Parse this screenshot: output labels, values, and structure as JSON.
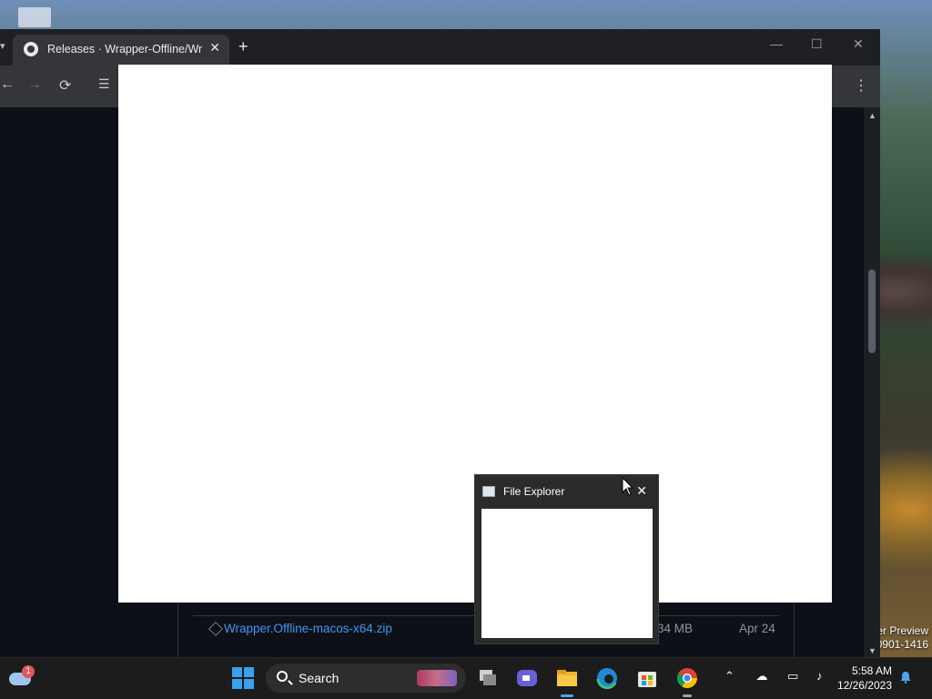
{
  "desktop": {
    "watermark_line1": "er Preview",
    "watermark_line2": "0901-1416"
  },
  "browser": {
    "tab_title": "Releases · Wrapper-Offline/Wra",
    "new_tab_label": "+",
    "assets": [
      {
        "name": "Wrapper.Offline-macos-x64.zip",
        "size": "34 MB",
        "date": "Apr 24"
      }
    ]
  },
  "file_explorer_preview": {
    "title": "File Explorer"
  },
  "taskbar": {
    "weather_badge": "1",
    "search_label": "Search",
    "time": "5:58 AM",
    "date": "12/26/2023"
  },
  "colors": {
    "taskbar_bg": "#1c1c1c",
    "link": "#4493f8",
    "page_bg": "#0d1117"
  }
}
